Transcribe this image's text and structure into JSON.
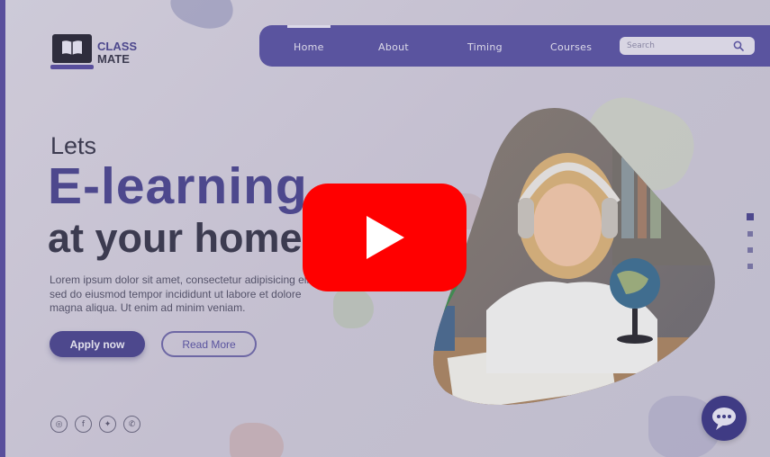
{
  "brand": {
    "line1": "CLASS",
    "line2": "MATE",
    "logo_icon": "laptop-book-icon"
  },
  "nav": {
    "items": [
      {
        "label": "Home",
        "active": true
      },
      {
        "label": "About",
        "active": false
      },
      {
        "label": "Timing",
        "active": false
      },
      {
        "label": "Courses",
        "active": false
      }
    ],
    "search": {
      "placeholder": "Search",
      "icon": "search-icon"
    }
  },
  "hero": {
    "line1": "Lets",
    "line2": "E-learning",
    "line3": "at your home",
    "description": "Lorem ipsum dolor sit amet, consectetur adipisicing elit, sed do eiusmod tempor incididunt ut labore et dolore magna aliqua. Ut enim ad minim veniam."
  },
  "buttons": {
    "apply": "Apply now",
    "read_more": "Read More"
  },
  "social": [
    {
      "name": "instagram-icon",
      "glyph": "◎"
    },
    {
      "name": "facebook-icon",
      "glyph": "f"
    },
    {
      "name": "twitter-icon",
      "glyph": "✦"
    },
    {
      "name": "whatsapp-icon",
      "glyph": "✆"
    }
  ],
  "slider": {
    "count": 4,
    "active_index": 0
  },
  "chat": {
    "icon": "chat-bubble-icon"
  },
  "video": {
    "icon": "youtube-play-icon"
  },
  "colors": {
    "primary": "#4d4890",
    "nav_bg": "#5b54a3",
    "dark_text": "#3b3a4e",
    "youtube_red": "#ff0000"
  }
}
